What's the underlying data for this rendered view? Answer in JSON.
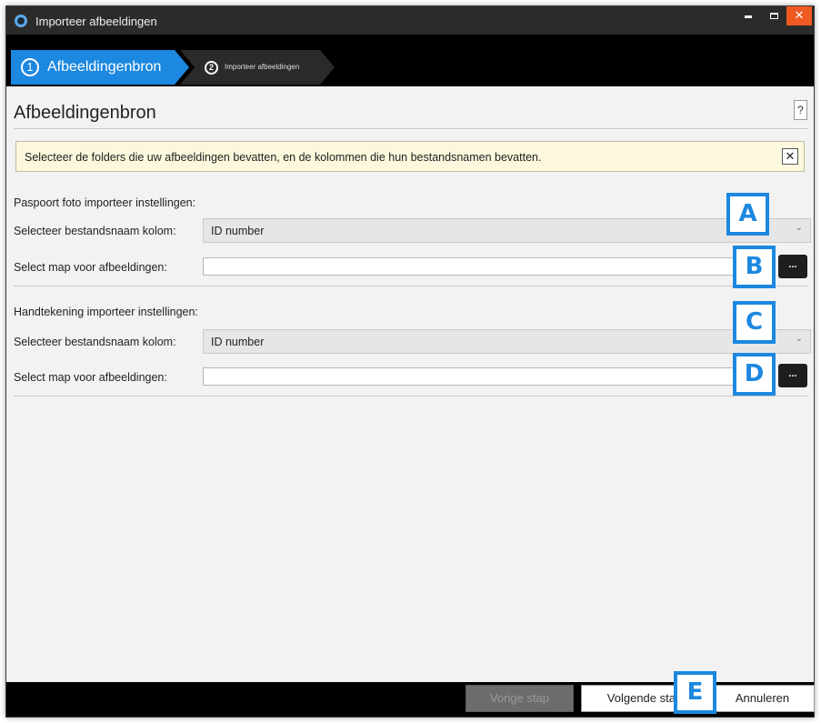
{
  "window": {
    "title": "Importeer afbeeldingen"
  },
  "steps": [
    {
      "number": "1",
      "label": "Afbeeldingenbron"
    },
    {
      "number": "2",
      "label": "Importeer afbeeldingen"
    }
  ],
  "page": {
    "title": "Afbeeldingenbron",
    "help_label": "?"
  },
  "info": {
    "text": "Selecteer de folders die uw afbeeldingen bevatten, en de kolommen die hun bestandsnamen bevatten.",
    "close_label": "✕"
  },
  "passport": {
    "title": "Paspoort foto importeer instellingen:",
    "column_label": "Selecteer bestandsnaam kolom:",
    "column_value": "ID number",
    "folder_label": "Select map voor afbeeldingen:",
    "folder_value": "",
    "browse_label": "..."
  },
  "signature": {
    "title": "Handtekening importeer instellingen:",
    "column_label": "Selecteer bestandsnaam kolom:",
    "column_value": "ID number",
    "folder_label": "Select map voor afbeeldingen:",
    "folder_value": "",
    "browse_label": "..."
  },
  "callouts": {
    "a": "A",
    "b": "B",
    "c": "C",
    "d": "D",
    "e": "E"
  },
  "footer": {
    "prev_label": "Vorige stap",
    "next_label": "Volgende stap",
    "cancel_label": "Annuleren"
  },
  "colors": {
    "accent": "#1c88e0",
    "close": "#f05a22",
    "info_bg": "#fcf8dd"
  },
  "icons": {
    "app": "app-logo-icon",
    "chevron": "chevron-down-icon",
    "help": "help-icon",
    "close": "close-icon"
  }
}
